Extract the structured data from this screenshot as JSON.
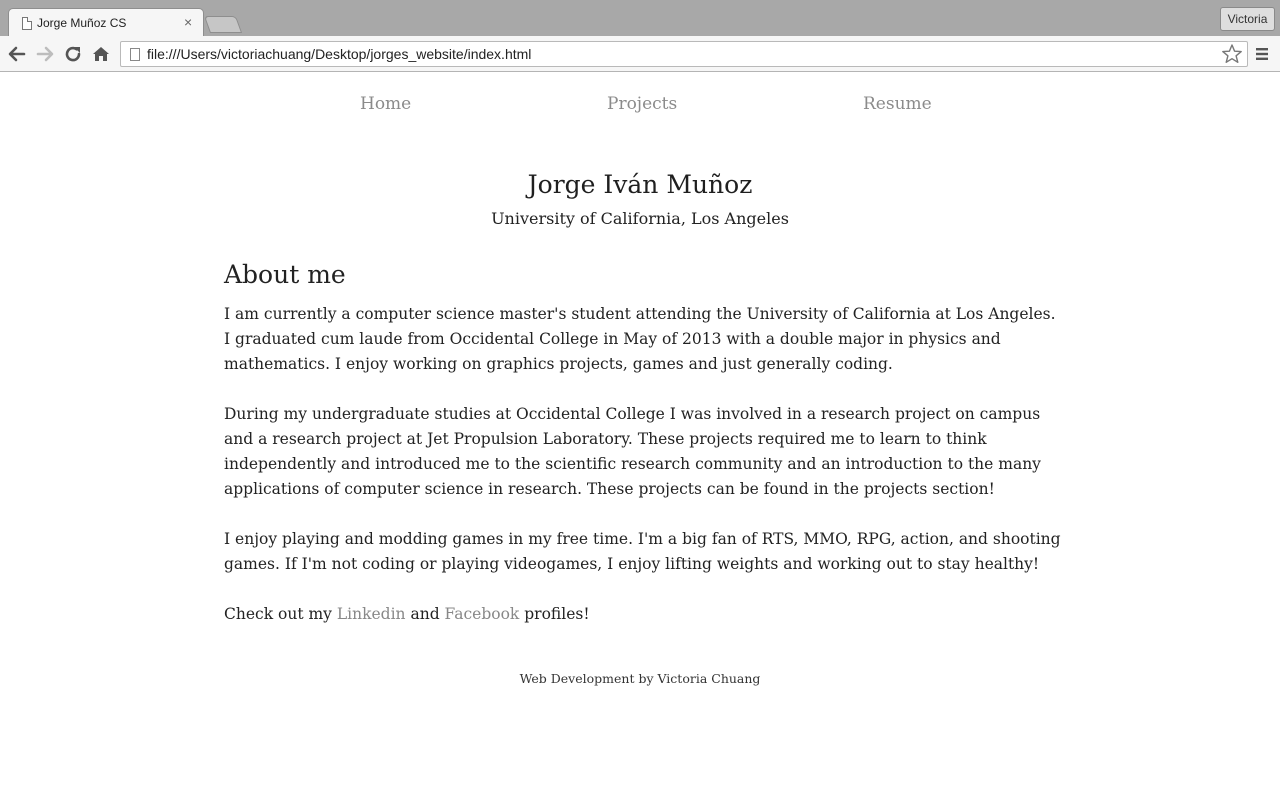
{
  "browser": {
    "tab_title": "Jorge Muñoz CS",
    "profile_name": "Victoria",
    "url": "file:///Users/victoriachuang/Desktop/jorges_website/index.html",
    "icons": [
      "document-icon",
      "close-icon",
      "back-icon",
      "forward-icon",
      "reload-icon",
      "home-icon",
      "star-icon",
      "menu-icon"
    ]
  },
  "site": {
    "nav": [
      "Home",
      "Projects",
      "Resume"
    ],
    "name": "Jorge Iván Muñoz",
    "school": "University of California, Los Angeles",
    "about_title": "About me",
    "paragraphs": [
      "I am currently a computer science master's student attending the University of California at Los Angeles. I graduated cum laude from Occidental College in May of 2013 with a double major in physics and mathematics. I enjoy working on graphics projects, games and just generally coding.",
      "During my undergraduate studies at Occidental College I was involved in a research project on campus and a research project at Jet Propulsion Laboratory. These projects required me to learn to think independently and introduced me to the scientific research community and an introduction to the many applications of computer science in research. These projects can be found in the projects section!",
      "I enjoy playing and modding games in my free time. I'm a big fan of RTS, MMO, RPG, action, and shooting games. If I'm not coding or playing videogames, I enjoy lifting weights and working out to stay healthy!"
    ],
    "links_line": {
      "prefix": "Check out my ",
      "linkedin": "Linkedin",
      "middle": " and ",
      "facebook": "Facebook",
      "suffix": " profiles!"
    },
    "footer": "Web Development by Victoria Chuang"
  },
  "colors": {
    "link": "#888888",
    "text": "#222222",
    "tabstrip": "#a8a8a8",
    "toolbar": "#f6f6f6"
  }
}
